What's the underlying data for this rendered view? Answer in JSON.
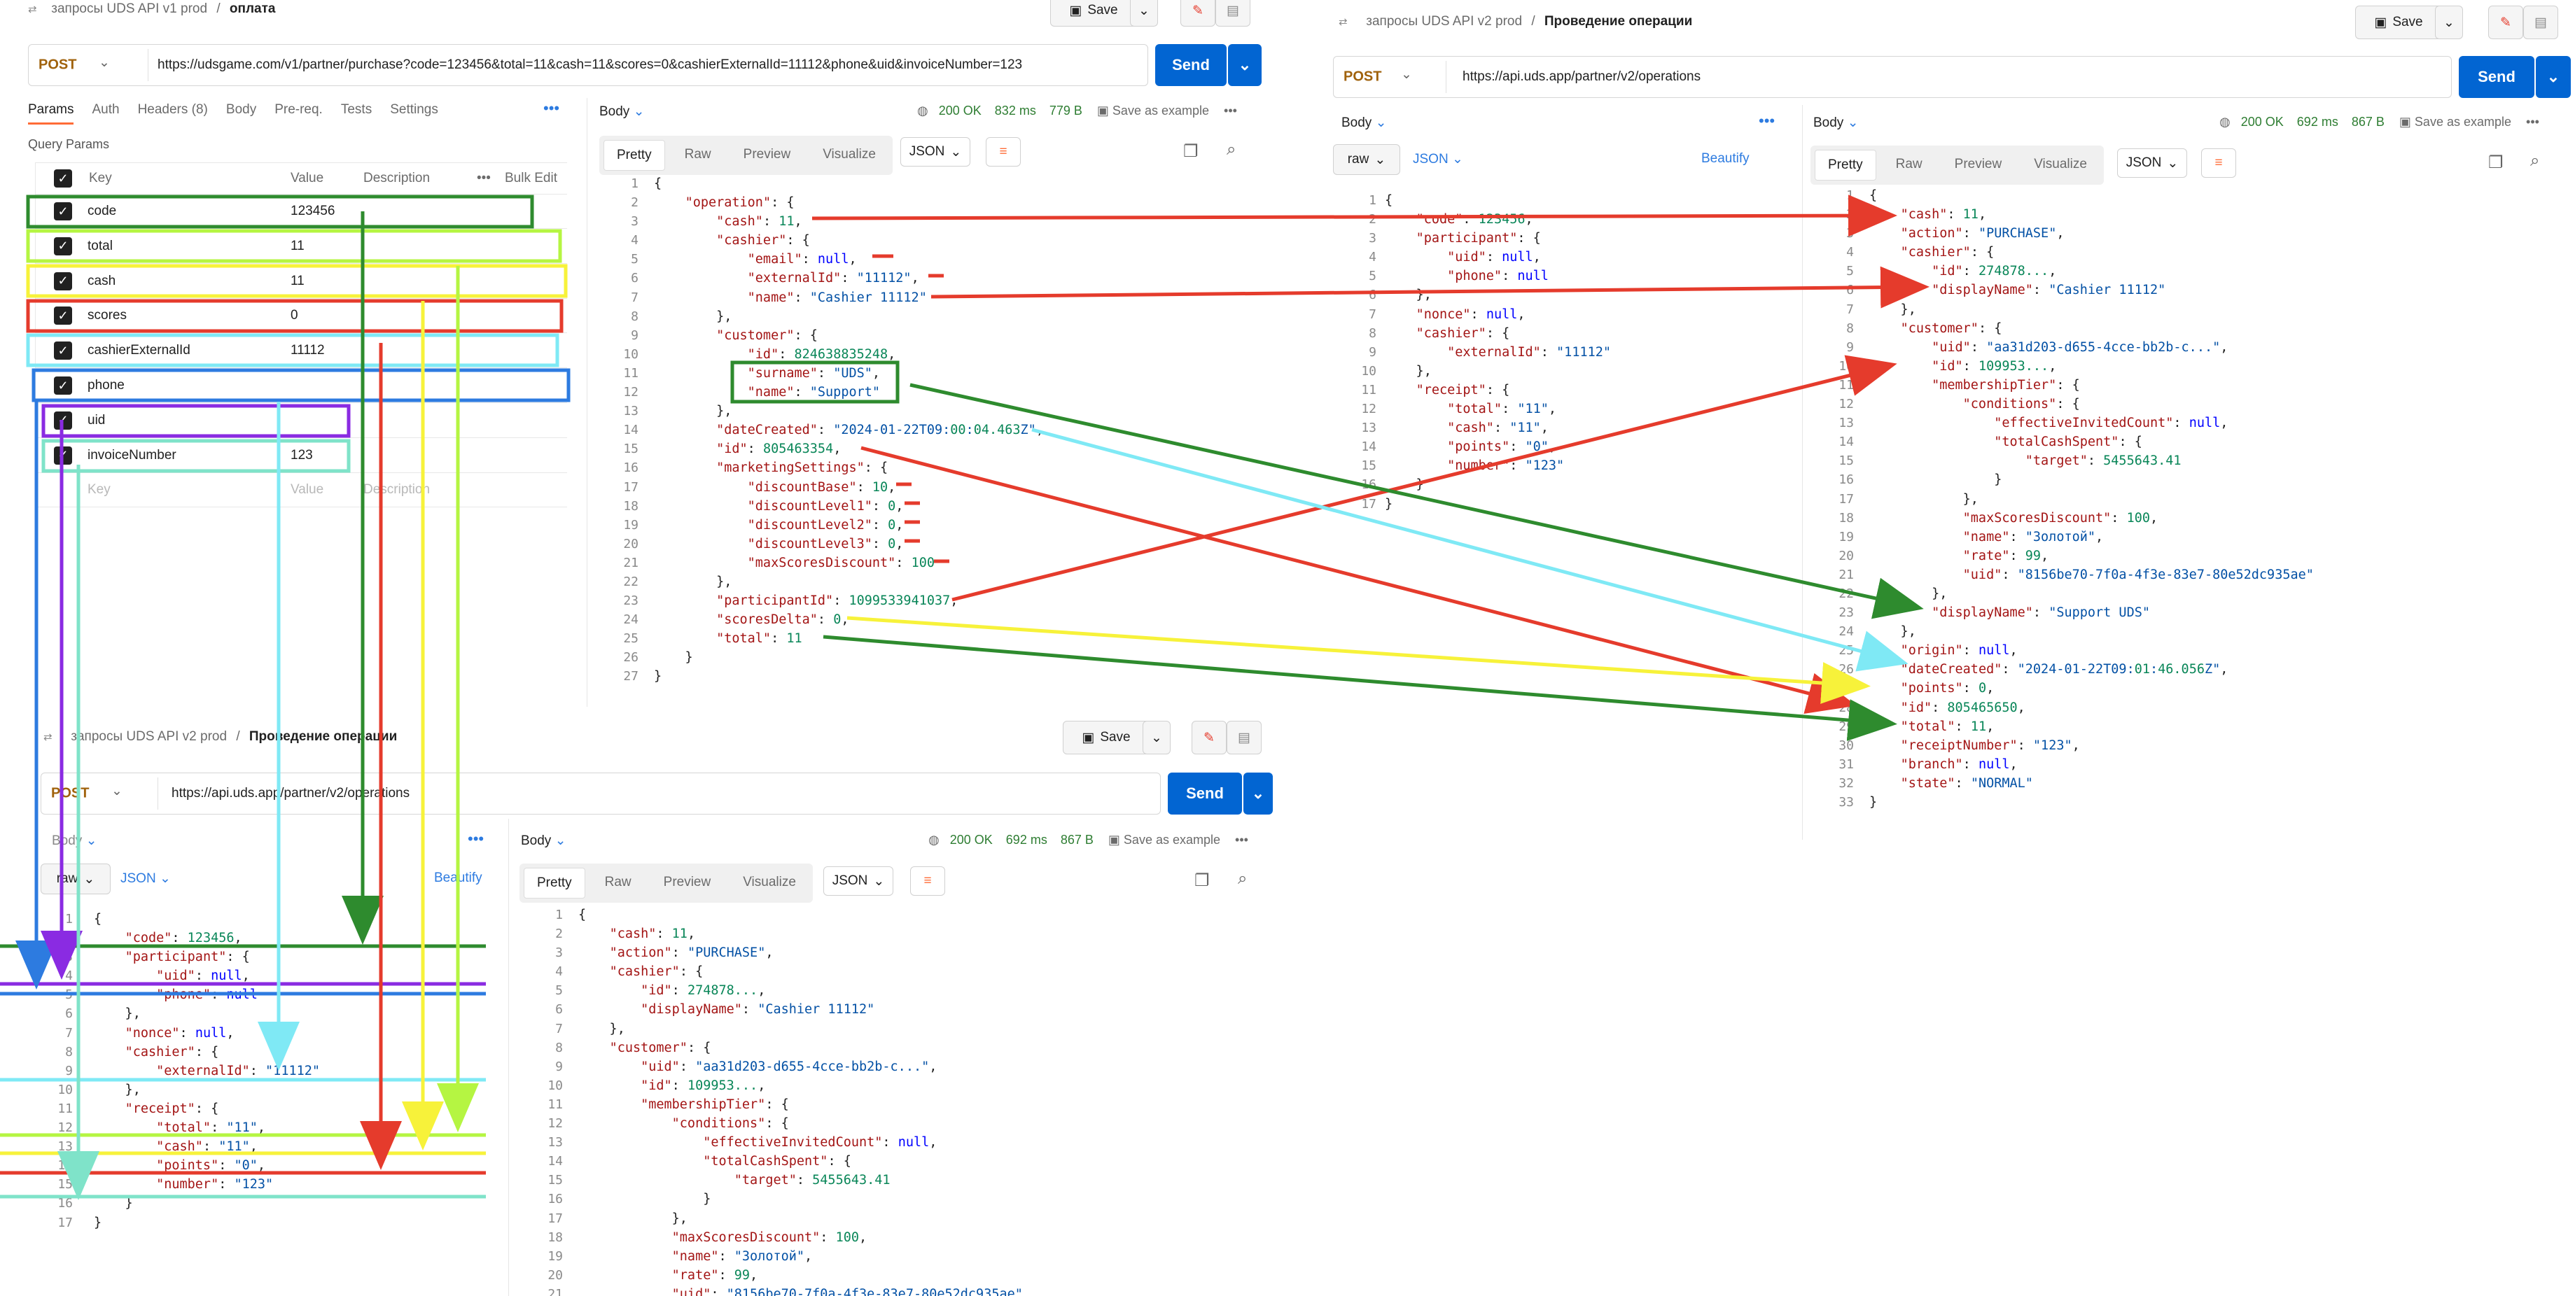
{
  "left_top": {
    "breadcrumb_collection": "запросы UDS API v1 prod",
    "breadcrumb_sep": "/",
    "breadcrumb_request": "оплата",
    "save_label": "Save",
    "method": "POST",
    "url": "https://udsgame.com/v1/partner/purchase?code=123456&total=11&cash=11&scores=0&cashierExternalId=11112&phone&uid&invoiceNumber=123",
    "send_label": "Send",
    "request_tabs": [
      "Params",
      "Auth",
      "Headers (8)",
      "Body",
      "Pre-req.",
      "Tests",
      "Settings"
    ],
    "query_params_title": "Query Params",
    "columns": {
      "key": "Key",
      "value": "Value",
      "description": "Description",
      "bulk": "Bulk Edit"
    },
    "params": [
      {
        "key": "code",
        "value": "123456"
      },
      {
        "key": "total",
        "value": "11"
      },
      {
        "key": "cash",
        "value": "11"
      },
      {
        "key": "scores",
        "value": "0"
      },
      {
        "key": "cashierExternalId",
        "value": "11112"
      },
      {
        "key": "phone",
        "value": ""
      },
      {
        "key": "uid",
        "value": ""
      },
      {
        "key": "invoiceNumber",
        "value": "123"
      }
    ],
    "placeholder_key": "Key",
    "placeholder_value": "Value",
    "placeholder_description": "Description",
    "response_body_label": "Body",
    "status": "200 OK",
    "time": "832 ms",
    "size": "779 B",
    "save_example": "Save as example",
    "view_tabs": [
      "Pretty",
      "Raw",
      "Preview",
      "Visualize"
    ],
    "format": "JSON"
  },
  "right_top": {
    "breadcrumb_collection": "запросы UDS API v2 prod",
    "breadcrumb_sep": "/",
    "breadcrumb_request": "Проведение операции",
    "save_label": "Save",
    "method": "POST",
    "url": "https://api.uds.app/partner/v2/operations",
    "send_label": "Send",
    "body_label": "Body",
    "raw_label": "raw",
    "format": "JSON",
    "beautify": "Beautify",
    "response_body_label": "Body",
    "status": "200 OK",
    "time": "692 ms",
    "size": "867 B",
    "save_example": "Save as example",
    "view_tabs": [
      "Pretty",
      "Raw",
      "Preview",
      "Visualize"
    ]
  },
  "left_bottom": {
    "breadcrumb_collection": "запросы UDS API v2 prod",
    "breadcrumb_sep": "/",
    "breadcrumb_request": "Проведение операции",
    "save_label": "Save",
    "method": "POST",
    "url": "https://api.uds.app/partner/v2/operations",
    "send_label": "Send",
    "body_label": "Body",
    "raw_label": "raw",
    "format": "JSON",
    "beautify": "Beautify",
    "response_body_label": "Body",
    "status": "200 OK",
    "time": "692 ms",
    "size": "867 B",
    "save_example": "Save as example",
    "view_tabs": [
      "Pretty",
      "Raw",
      "Preview",
      "Visualize"
    ]
  },
  "code": {
    "v1_response": [
      "{",
      "    \"operation\": {",
      "        \"cash\": 11,",
      "        \"cashier\": {",
      "            \"email\": null,",
      "            \"externalId\": \"11112\",",
      "            \"name\": \"Cashier 11112\"",
      "        },",
      "        \"customer\": {",
      "            \"id\": 824638835248,",
      "            \"surname\": \"UDS\",",
      "            \"name\": \"Support\"",
      "        },",
      "        \"dateCreated\": \"2024-01-22T09:00:04.463Z\",",
      "        \"id\": 805463354,",
      "        \"marketingSettings\": {",
      "            \"discountBase\": 10,",
      "            \"discountLevel1\": 0,",
      "            \"discountLevel2\": 0,",
      "            \"discountLevel3\": 0,",
      "            \"maxScoresDiscount\": 100",
      "        },",
      "        \"participantId\": 1099533941037,",
      "        \"scoresDelta\": 0,",
      "        \"total\": 11",
      "    }",
      "}"
    ],
    "v2_request": [
      "{",
      "    \"code\": 123456,",
      "    \"participant\": {",
      "        \"uid\": null,",
      "        \"phone\": null",
      "    },",
      "    \"nonce\": null,",
      "    \"cashier\": {",
      "        \"externalId\": \"11112\"",
      "    },",
      "    \"receipt\": {",
      "        \"total\": \"11\",",
      "        \"cash\": \"11\",",
      "        \"points\": \"0\",",
      "        \"number\": \"123\"",
      "    }",
      "}"
    ],
    "v2_response": [
      "{",
      "    \"cash\": 11,",
      "    \"action\": \"PURCHASE\",",
      "    \"cashier\": {",
      "        \"id\": 274878...,",
      "        \"displayName\": \"Cashier 11112\"",
      "    },",
      "    \"customer\": {",
      "        \"uid\": \"aa31d203-d655-4cce-bb2b-c...\",",
      "        \"id\": 109953...,",
      "        \"membershipTier\": {",
      "            \"conditions\": {",
      "                \"effectiveInvitedCount\": null,",
      "                \"totalCashSpent\": {",
      "                    \"target\": 5455643.41",
      "                }",
      "            },",
      "            \"maxScoresDiscount\": 100,",
      "            \"name\": \"Золотой\",",
      "            \"rate\": 99,",
      "            \"uid\": \"8156be70-7f0a-4f3e-83e7-80e52dc935ae\"",
      "        },",
      "        \"displayName\": \"Support UDS\"",
      "    },",
      "    \"origin\": null,",
      "    \"dateCreated\": \"2024-01-22T09:01:46.056Z\",",
      "    \"points\": 0,",
      "    \"id\": 805465650,",
      "    \"total\": 11,",
      "    \"receiptNumber\": \"123\",",
      "    \"branch\": null,",
      "    \"state\": \"NORMAL\"",
      "}"
    ],
    "v2_response_bottom_count": 21
  },
  "colors": {
    "green": "#2e8b2e",
    "lime": "#b5f542",
    "yellow": "#f7f23a",
    "red": "#e53b2c",
    "cyan": "#7fe9f5",
    "blue": "#2d7be0",
    "purple": "#8a2be2",
    "teal": "#7fe3c9",
    "send": "#0265d2"
  }
}
